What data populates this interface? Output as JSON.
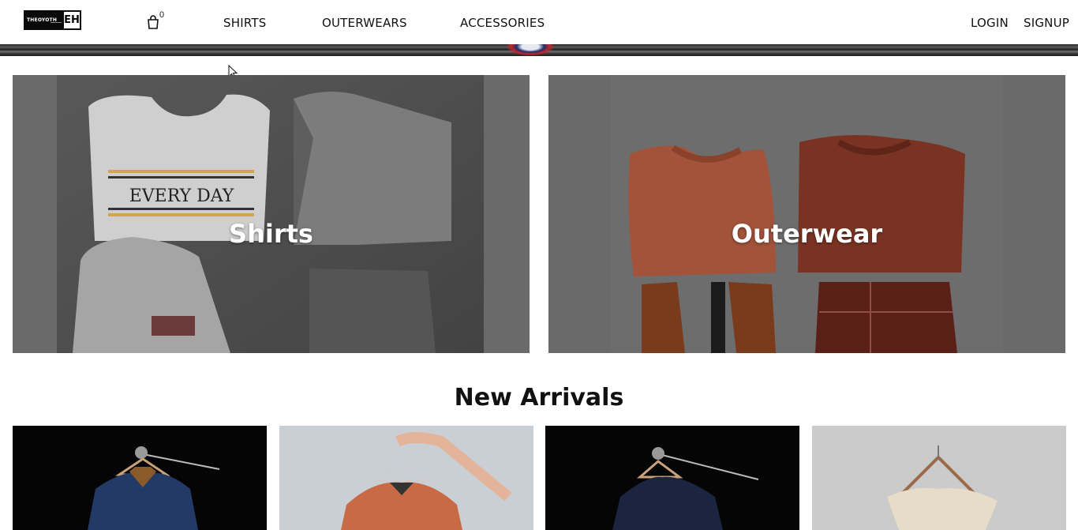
{
  "header": {
    "logo_text": "THEOYOTH",
    "logo_mark": "EH",
    "cart_count": "0",
    "nav": {
      "shirts": "SHIRTS",
      "outerwears": "OUTERWEARS",
      "accessories": "ACCESSORIES"
    },
    "login": "LOGIN",
    "signup": "SIGNUP"
  },
  "categories": [
    {
      "title": "Shirts"
    },
    {
      "title": "Outerwear"
    }
  ],
  "new_arrivals": {
    "title": "New Arrivals"
  },
  "icons": {
    "cart": "shopping-bag-icon"
  },
  "colors": {
    "header_bg": "#ffffff",
    "text": "#111111",
    "card_overlay": "#6a6a6a"
  }
}
